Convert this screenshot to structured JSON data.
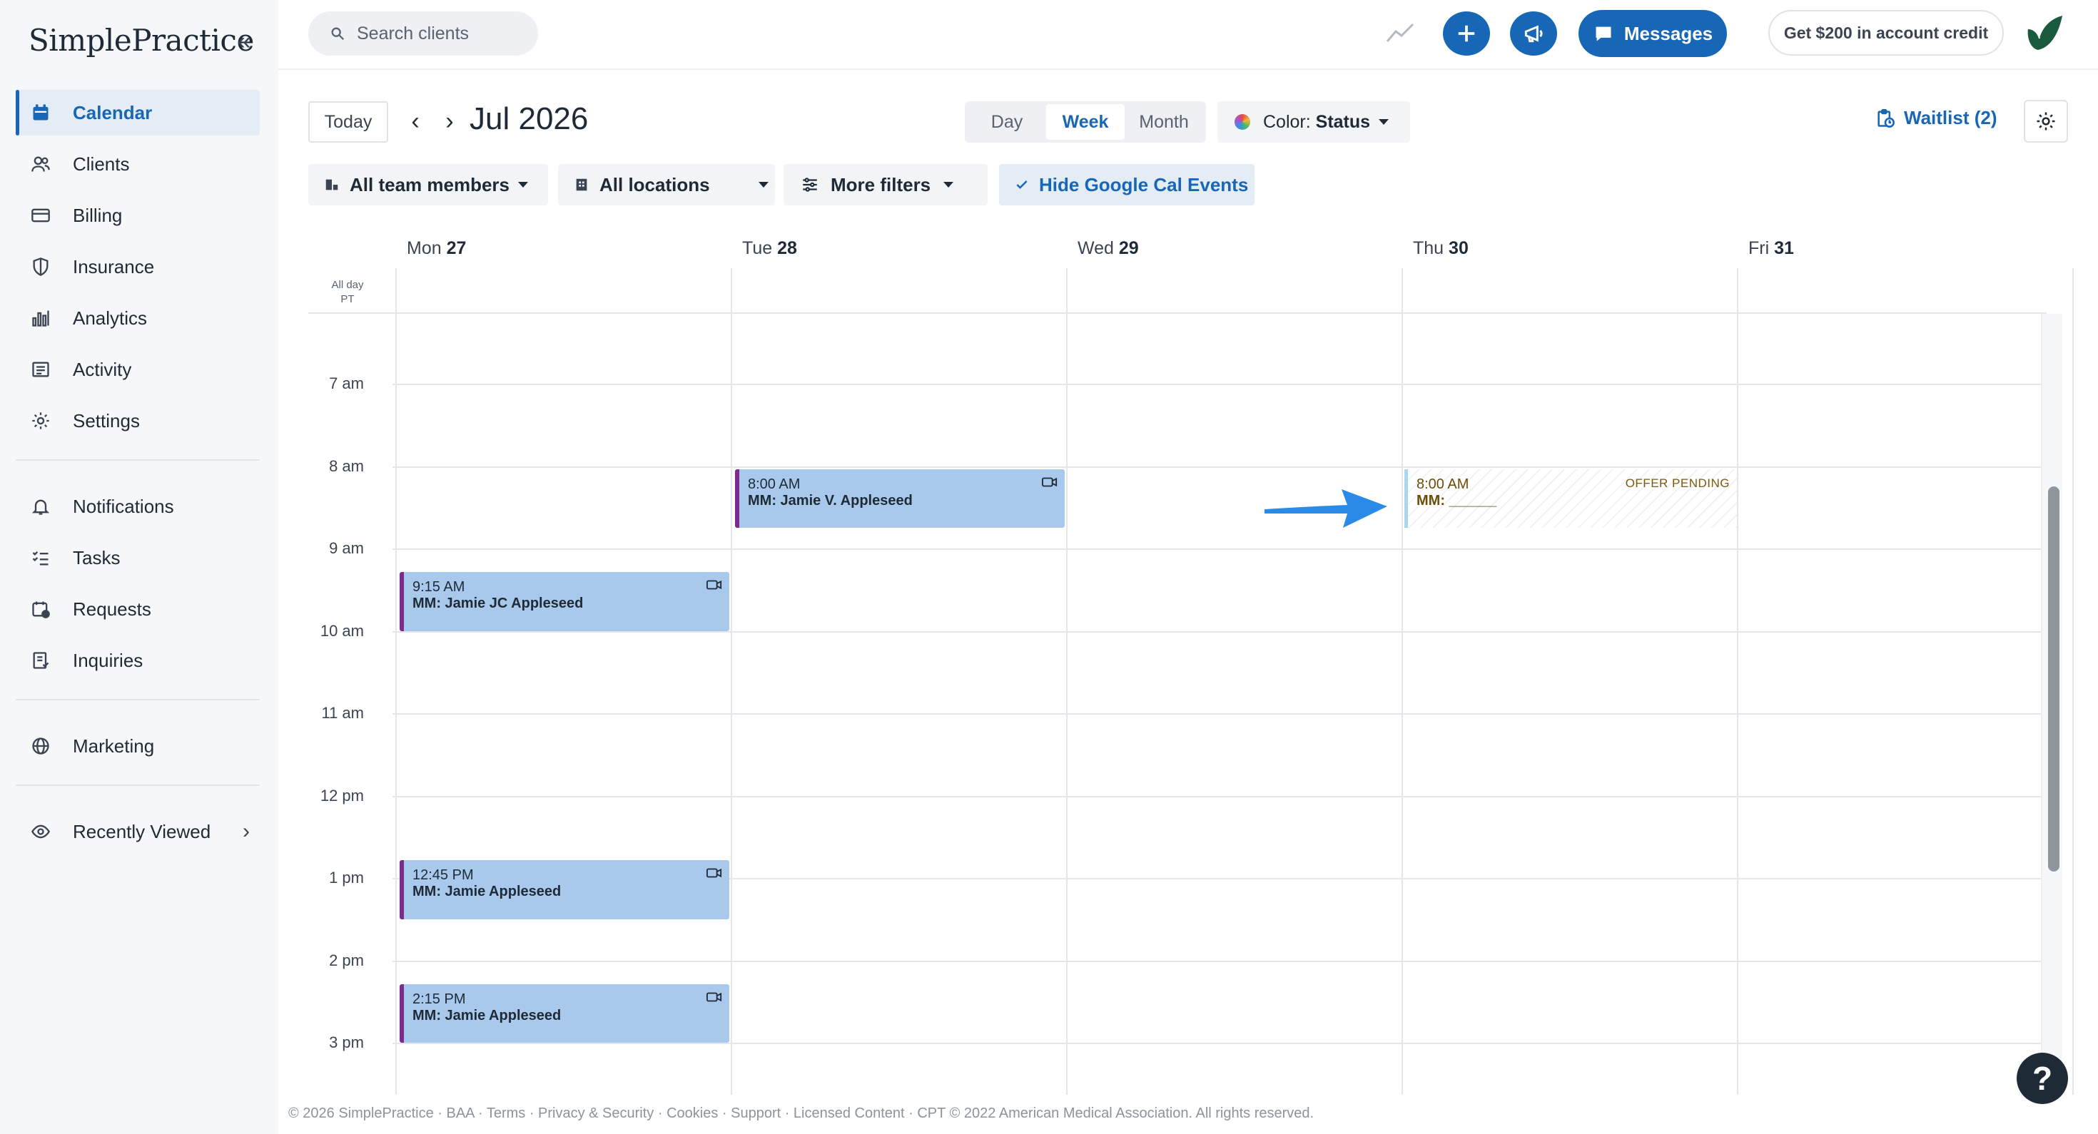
{
  "brand": {
    "logo_text": "SimplePractice"
  },
  "sidebar": {
    "items": [
      {
        "label": "Calendar",
        "icon": "calendar-icon",
        "active": true
      },
      {
        "label": "Clients",
        "icon": "users-icon"
      },
      {
        "label": "Billing",
        "icon": "credit-card-icon"
      },
      {
        "label": "Insurance",
        "icon": "shield-icon"
      },
      {
        "label": "Analytics",
        "icon": "bar-chart-icon"
      },
      {
        "label": "Activity",
        "icon": "list-icon"
      },
      {
        "label": "Settings",
        "icon": "gear-icon"
      }
    ],
    "items2": [
      {
        "label": "Notifications",
        "icon": "bell-icon"
      },
      {
        "label": "Tasks",
        "icon": "checklist-icon"
      },
      {
        "label": "Requests",
        "icon": "calendar-check-icon"
      },
      {
        "label": "Inquiries",
        "icon": "document-icon"
      }
    ],
    "marketing": {
      "label": "Marketing",
      "icon": "globe-icon"
    },
    "recently_viewed": {
      "label": "Recently Viewed",
      "icon": "eye-icon"
    }
  },
  "topbar": {
    "search_placeholder": "Search clients",
    "messages_label": "Messages",
    "credit_label": "Get $200 in account credit"
  },
  "toolbar": {
    "today_label": "Today",
    "period_title": "Jul 2026",
    "views": [
      "Day",
      "Week",
      "Month"
    ],
    "active_view": "Week",
    "color_prefix": "Color: ",
    "color_value": "Status",
    "waitlist_label": "Waitlist (2)"
  },
  "filters": {
    "team": "All team members",
    "locations": "All locations",
    "more": "More filters",
    "google": "Hide Google Cal Events"
  },
  "calendar": {
    "days": [
      {
        "dow": "Mon",
        "date": "27"
      },
      {
        "dow": "Tue",
        "date": "28"
      },
      {
        "dow": "Wed",
        "date": "29"
      },
      {
        "dow": "Thu",
        "date": "30"
      },
      {
        "dow": "Fri",
        "date": "31"
      }
    ],
    "allday_label": "All day",
    "tz_label": "PT",
    "hours": [
      "7 am",
      "8 am",
      "9 am",
      "10 am",
      "11 am",
      "12 pm",
      "1 pm",
      "2 pm",
      "3 pm"
    ],
    "events": [
      {
        "day": 1,
        "start_hour": 8.0,
        "end_hour": 8.75,
        "time": "8:00 AM",
        "title": "MM: Jamie V. Appleseed"
      },
      {
        "day": 0,
        "start_hour": 9.25,
        "end_hour": 10.0,
        "time": "9:15 AM",
        "title": "MM: Jamie JC Appleseed"
      },
      {
        "day": 0,
        "start_hour": 12.75,
        "end_hour": 13.5,
        "time": "12:45 PM",
        "title": "MM: Jamie Appleseed"
      },
      {
        "day": 0,
        "start_hour": 14.25,
        "end_hour": 15.0,
        "time": "2:15 PM",
        "title": "MM: Jamie Appleseed"
      }
    ],
    "offer": {
      "day": 3,
      "time": "8:00 AM",
      "title": "MM: ______",
      "tag": "OFFER PENDING"
    }
  },
  "help_label": "?",
  "footer_text": "© 2026 SimplePractice · BAA · Terms · Privacy & Security · Cookies · Support · Licensed Content · CPT © 2022 American Medical Association. All rights reserved.",
  "colors": {
    "accent": "#1767b6",
    "event_fill": "#a8c8ec",
    "event_border": "#7b2b8c"
  }
}
